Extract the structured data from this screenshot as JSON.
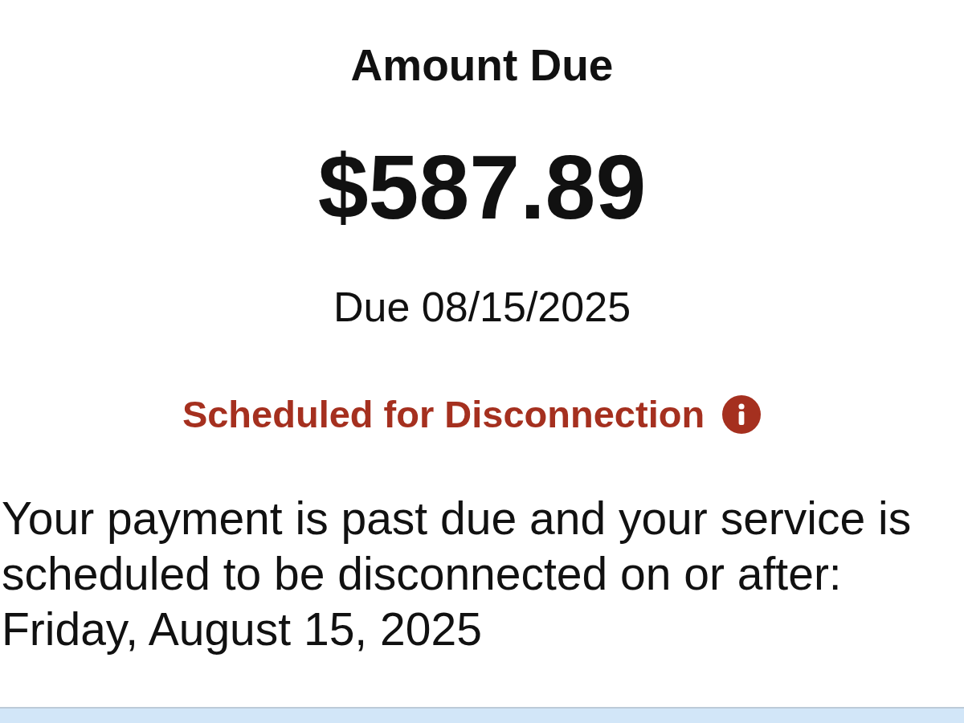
{
  "amount_due": {
    "title": "Amount Due",
    "amount": "$587.89",
    "due_date": "Due 08/15/2025"
  },
  "status": {
    "label": "Scheduled for Disconnection"
  },
  "message": "Your payment is past due and your service is scheduled to be disconnected on or after: Friday, August 15, 2025"
}
